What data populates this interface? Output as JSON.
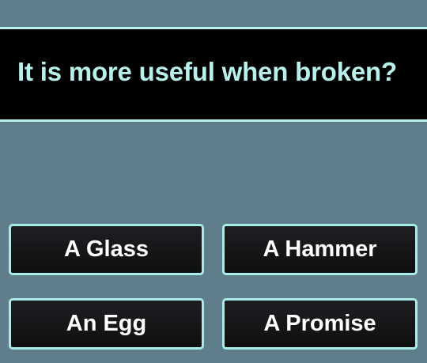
{
  "question": {
    "text": "It is more useful when broken?"
  },
  "answers": [
    {
      "label": "A Glass"
    },
    {
      "label": "A Hammer"
    },
    {
      "label": "An Egg"
    },
    {
      "label": "A Promise"
    }
  ],
  "colors": {
    "background": "#607d8b",
    "banner": "#000000",
    "accent": "#b8f1ec",
    "button": "#111214",
    "button_text": "#ffffff"
  }
}
